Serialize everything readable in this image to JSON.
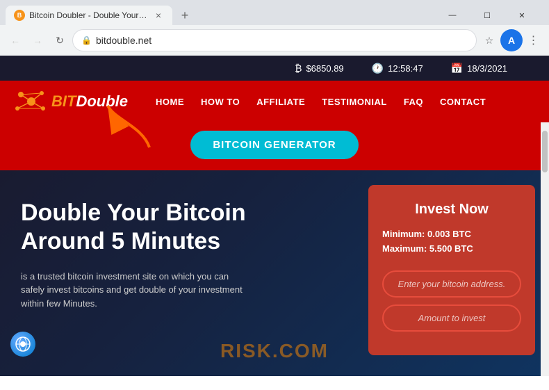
{
  "browser": {
    "tab": {
      "favicon_label": "B",
      "title": "Bitcoin Doubler - Double Your B...",
      "close_label": "×",
      "new_tab_label": "+"
    },
    "window_controls": {
      "minimize": "—",
      "maximize": "☐",
      "close": "✕"
    },
    "address_bar": {
      "lock_icon": "🔒",
      "url": "bitdouble.net"
    },
    "nav": {
      "back": "←",
      "forward": "→",
      "reload": "↻"
    }
  },
  "site": {
    "ticker": {
      "price_icon": "₿",
      "price": "$6850.89",
      "time_icon": "🕐",
      "time": "12:58:47",
      "date_icon": "📅",
      "date": "18/3/2021"
    },
    "logo": {
      "text_bit": "BIT",
      "text_double": "Double"
    },
    "nav_links": [
      "HOME",
      "HOW TO",
      "AFFILIATE",
      "TESTIMONIAL",
      "FAQ",
      "CONTACT"
    ],
    "generator_button": "BITCOIN GENERATOR",
    "hero": {
      "title": "Double Your Bitcoin\nAround 5 Minutes",
      "subtitle": "is a trusted bitcoin investment site on which you can safely invest bitcoins and get double of your investment within few Minutes."
    },
    "invest_card": {
      "title": "Invest Now",
      "minimum": "Minimum: 0.003 BTC",
      "maximum": "Maximum: 5.500 BTC",
      "address_placeholder": "Enter your bitcoin address.",
      "amount_placeholder": "Amount to invest"
    },
    "watermark": "RISK.COM"
  }
}
